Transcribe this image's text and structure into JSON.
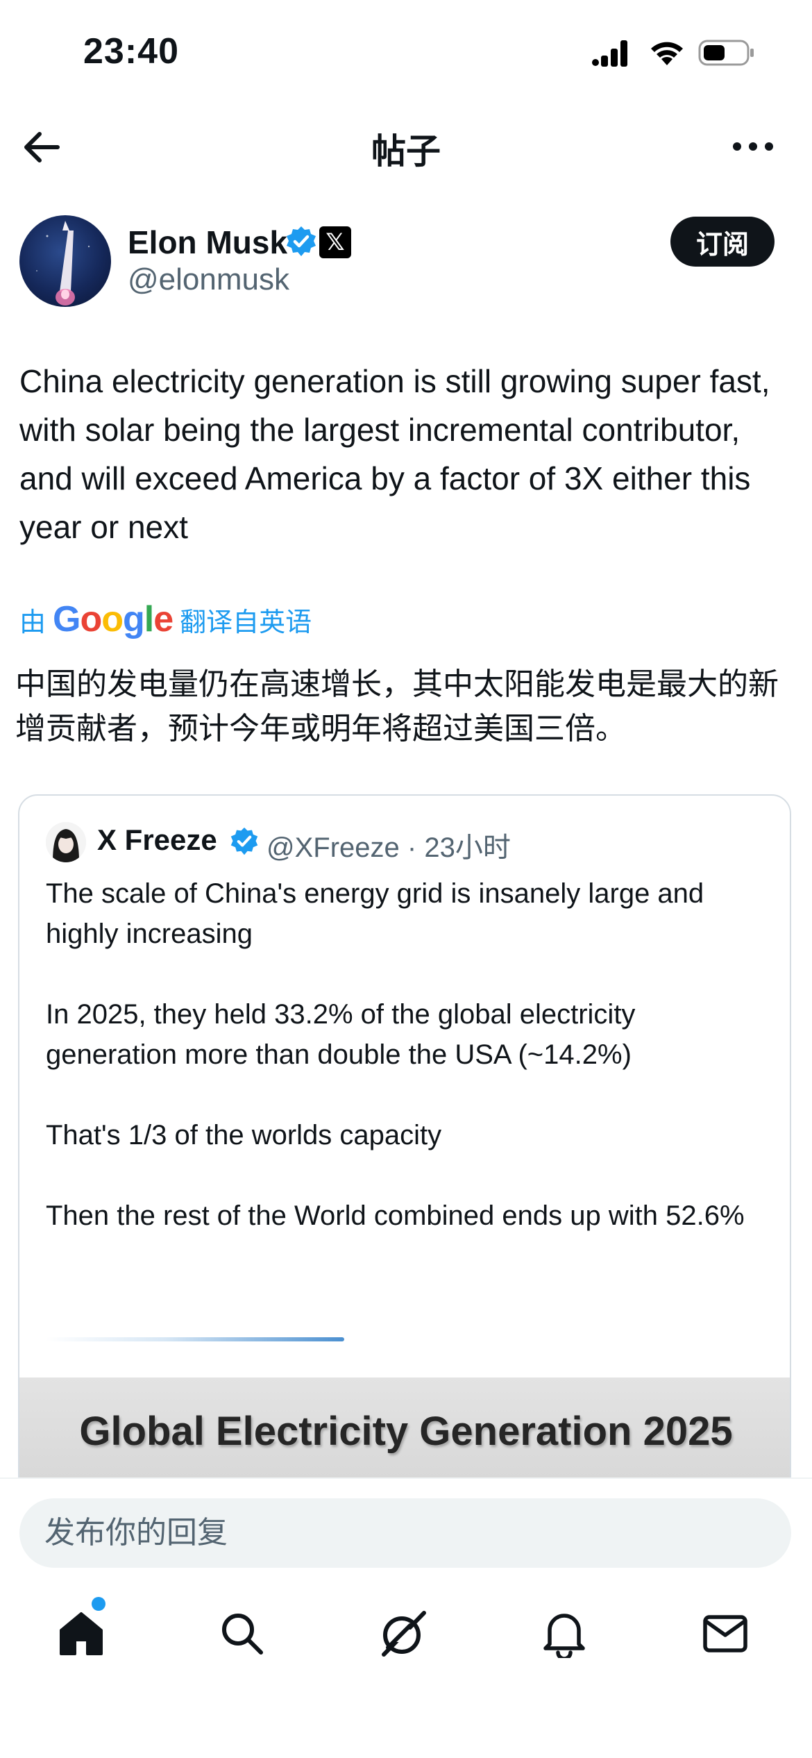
{
  "status_bar": {
    "time": "23:40"
  },
  "header": {
    "title": "帖子"
  },
  "author": {
    "name": "Elon Musk",
    "handle": "@elonmusk",
    "subscribe_label": "订阅"
  },
  "post": {
    "text": "China electricity generation is still growing super fast, with solar being the largest incremental contributor, and will exceed America by a factor of 3X either this year or next"
  },
  "translation": {
    "prefix": "由",
    "brand": "Google",
    "suffix": "翻译自英语",
    "text": "中国的发电量仍在高速增长，其中太阳能发电是最大的新增贡献者，预计今年或明年将超过美国三倍。"
  },
  "quote": {
    "name": "X Freeze",
    "handle_time": "@XFreeze · 23小时",
    "paragraphs": [
      "The scale of China's energy grid is insanely large and highly increasing",
      "In 2025, they held 33.2% of the global electricity generation more than double the USA (~14.2%)",
      "That's 1/3 of the worlds capacity",
      "Then the rest of the World combined ends up with 52.6%"
    ],
    "media_title": "Global Electricity Generation 2025"
  },
  "reply": {
    "placeholder": "发布你的回复"
  },
  "colors": {
    "accent": "#1d9bf0",
    "text": "#0f1419",
    "muted": "#536471"
  }
}
